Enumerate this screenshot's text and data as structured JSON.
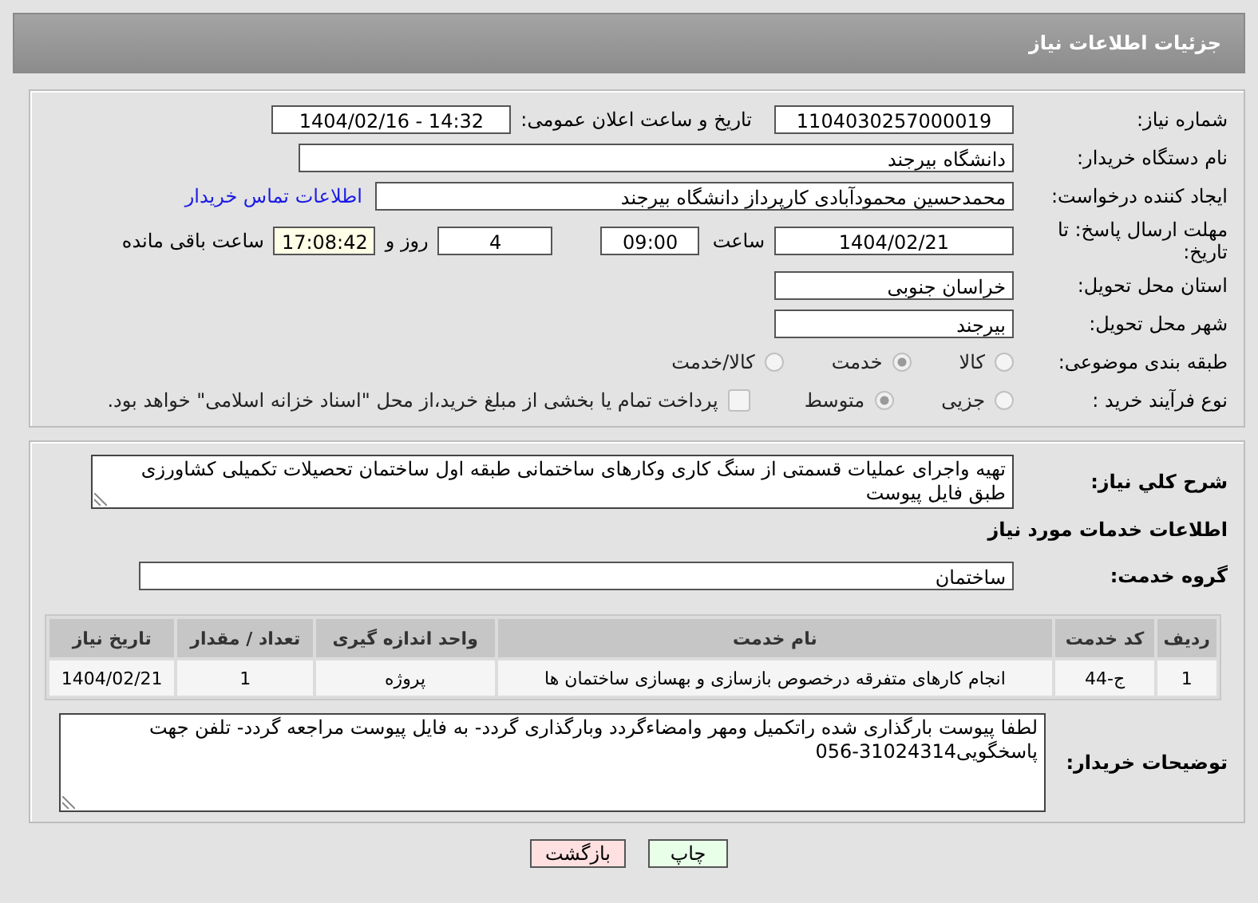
{
  "header": {
    "title": "جزئیات اطلاعات نیاز"
  },
  "need_number": {
    "label": "شماره نیاز:",
    "value": "1104030257000019"
  },
  "announce_date": {
    "label": "تاریخ و ساعت اعلان عمومی:",
    "value": "1404/02/16 - 14:32"
  },
  "buyer_org": {
    "label": "نام دستگاه خریدار:",
    "value": "دانشگاه بیرجند"
  },
  "requester": {
    "label": "ایجاد کننده درخواست:",
    "value": "محمدحسین محمودآبادی کارپرداز دانشگاه بیرجند",
    "link": "اطلاعات تماس خریدار"
  },
  "deadline": {
    "label": "مهلت ارسال پاسخ: تا تاریخ:",
    "date": "1404/02/21",
    "time_label": "ساعت",
    "time": "09:00",
    "days": "4",
    "days_label": "روز و",
    "remaining": "17:08:42",
    "remaining_label": "ساعت باقی مانده"
  },
  "province": {
    "label": "استان محل تحویل:",
    "value": "خراسان جنوبی"
  },
  "city": {
    "label": "شهر محل تحویل:",
    "value": "بیرجند"
  },
  "category": {
    "label": "طبقه بندی موضوعی:",
    "options": [
      {
        "label": "کالا",
        "selected": false
      },
      {
        "label": "خدمت",
        "selected": true
      },
      {
        "label": "کالا/خدمت",
        "selected": false
      }
    ]
  },
  "process": {
    "label": "نوع فرآیند خرید :",
    "options": [
      {
        "label": "جزیی",
        "selected": false
      },
      {
        "label": "متوسط",
        "selected": true
      }
    ],
    "treasury": {
      "checked": false,
      "text": "پرداخت تمام یا بخشی از مبلغ خرید،از محل \"اسناد خزانه اسلامی\" خواهد بود."
    }
  },
  "description": {
    "label": "شرح کلي نياز:",
    "value": "تهیه واجرای عملیات قسمتی از سنگ کاری وکارهای ساختمانی طبقه اول ساختمان تحصیلات تکمیلی کشاورزی طبق فایل پیوست"
  },
  "services_heading": "اطلاعات خدمات مورد نیاز",
  "service_group": {
    "label": "گروه خدمت:",
    "value": "ساختمان"
  },
  "table": {
    "columns": [
      "ردیف",
      "کد خدمت",
      "نام خدمت",
      "واحد اندازه گیری",
      "تعداد / مقدار",
      "تاریخ نیاز"
    ],
    "rows": [
      [
        "1",
        "ج-44",
        "انجام کارهای متفرقه درخصوص بازسازی و بهسازی ساختمان ها",
        "پروژه",
        "1",
        "1404/02/21"
      ]
    ]
  },
  "buyer_notes": {
    "label": "توضیحات خریدار:",
    "value": "لطفا پیوست بارگذاری شده راتکمیل ومهر وامضاءگردد وبارگذاری گردد- به فایل پیوست مراجعه گردد- تلفن جهت پاسخگویی31024314-056"
  },
  "buttons": [
    {
      "label": "چاپ",
      "kind": "print"
    },
    {
      "label": "بازگشت",
      "kind": "back"
    }
  ]
}
